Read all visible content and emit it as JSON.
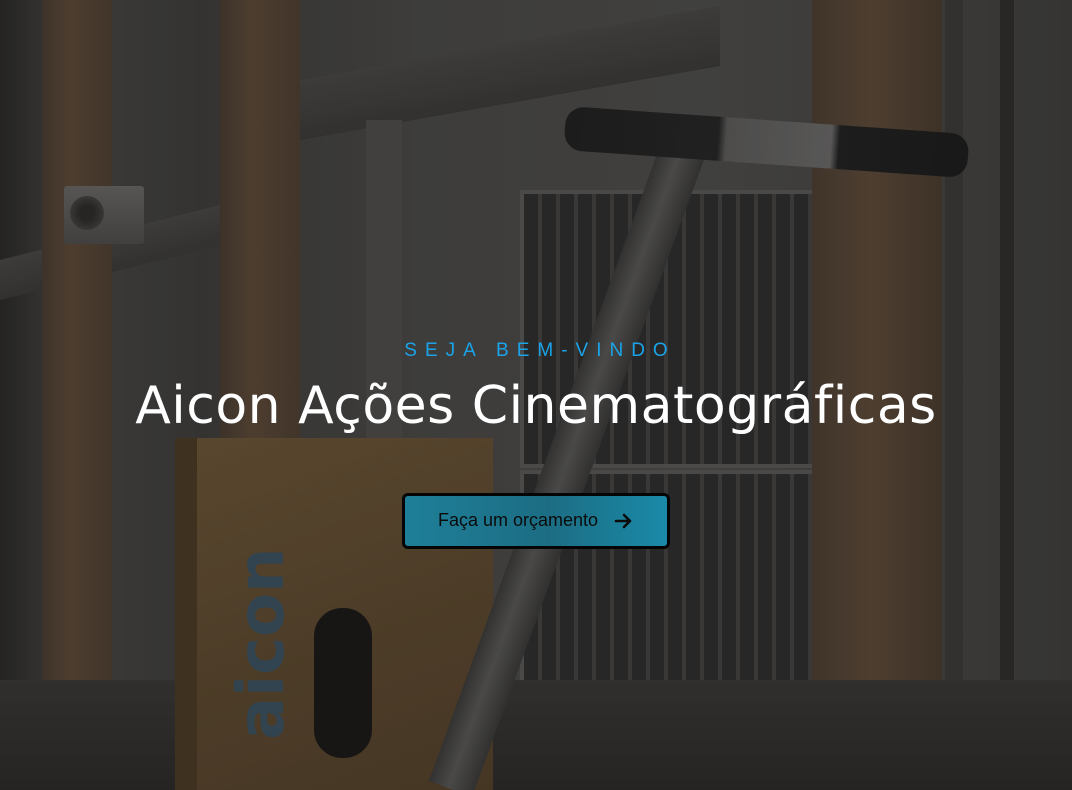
{
  "hero": {
    "eyebrow": "SEJA BEM-VINDO",
    "title": "Aicon Ações Cinematográficas",
    "cta": {
      "label": "Faça um orçamento",
      "icon": "arrow-right-icon"
    },
    "background_image": "dark photo of a building corridor with a wooden apple box marked 'aicon' and a metal stand"
  },
  "colors": {
    "eyebrow": "#1aa3e8",
    "title": "#ffffff",
    "cta_background": "#1e7f99",
    "cta_border": "#050505",
    "cta_text": "#0b0b0b"
  }
}
